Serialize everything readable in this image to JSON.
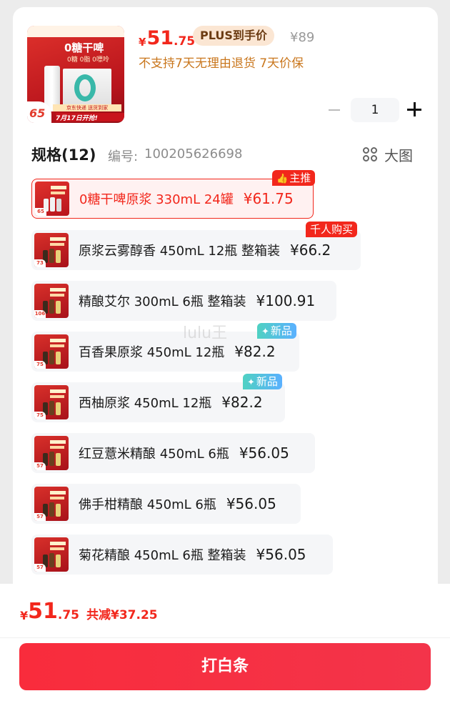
{
  "product": {
    "price_currency": "¥",
    "price_int": "51",
    "price_dec": ".75",
    "plus_tag": "PLUS到手价",
    "original_price": "¥89",
    "notice": "不支持7天无理由退货 7天价保",
    "thumb_headline": "0糖干啤",
    "thumb_sub": "0糖 0脂 0嘌呤",
    "thumb_badge": "65",
    "thumb_strip": "京东快递 送货到家",
    "thumb_date": "7月17日开抢!"
  },
  "quantity": {
    "value": "1"
  },
  "spec_header": {
    "title": "规格(12)",
    "code_label": "编号:",
    "code": "100205626698",
    "bigview_label": "大图"
  },
  "spec_items": [
    {
      "label": "0糖干啤原浆 330mL 24罐",
      "price": "¥61.75",
      "thumb_num": "65",
      "tag": "主推",
      "selected": true
    },
    {
      "label": "原浆云雾醇香 450mL 12瓶 整箱装",
      "price": "¥66.2",
      "thumb_num": "73",
      "tag": "千人购买"
    },
    {
      "label": "精酿艾尔 300mL 6瓶 整箱装",
      "price": "¥100.91",
      "thumb_num": "106"
    },
    {
      "label": "百香果原浆 450mL 12瓶",
      "price": "¥82.2",
      "thumb_num": "75",
      "tag": "新品"
    },
    {
      "label": "西柚原浆 450mL 12瓶",
      "price": "¥82.2",
      "thumb_num": "75",
      "tag": "新品"
    },
    {
      "label": "红豆薏米精酿 450mL 6瓶",
      "price": "¥56.05",
      "thumb_num": "57"
    },
    {
      "label": "佛手柑精酿 450mL 6瓶",
      "price": "¥56.05",
      "thumb_num": "57"
    },
    {
      "label": "菊花精酿 450mL 6瓶 整箱装",
      "price": "¥56.05",
      "thumb_num": "57"
    }
  ],
  "watermark": "lulu王",
  "footer": {
    "currency": "¥",
    "total_int": "51",
    "total_dec": ".75",
    "saved": "共减¥37.25",
    "buy_label": "打白条"
  },
  "colors": {
    "accent": "#f2271c",
    "plus_tag_bg": "#fbe6d3",
    "notice": "#c9761c",
    "new_tag": "#4fd1c2"
  }
}
